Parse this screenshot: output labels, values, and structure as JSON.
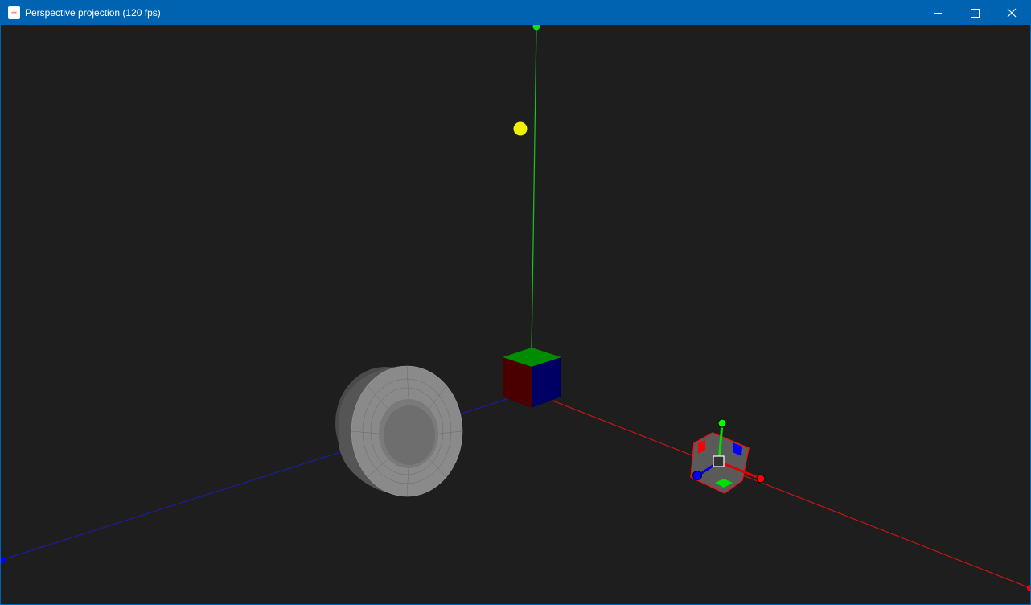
{
  "window": {
    "title": "Perspective projection (120 fps)",
    "app_icon": "java-cup-icon",
    "controls": [
      "minimize-icon",
      "maximize-icon",
      "close-icon"
    ]
  },
  "scene": {
    "background": "#1e1e1e",
    "axes": {
      "x_color": "#d01010",
      "y_color": "#10d010",
      "z_color": "#1010a0"
    },
    "light_color": "#f0f000",
    "mesh_color": "#808080",
    "gizmo": {
      "x_color": "#ff0000",
      "y_color": "#00ff00",
      "z_color": "#0000ff"
    }
  }
}
